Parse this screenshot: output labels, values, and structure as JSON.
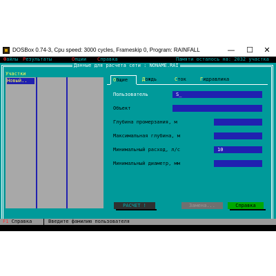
{
  "window": {
    "title": "DOSBox 0.74-3, Cpu speed:    3000 cycles, Frameskip  0, Program: RAINFALL",
    "minimize": "—",
    "maximize": "☐",
    "close": "✕"
  },
  "menu": {
    "items": [
      {
        "hotkey": "Ф",
        "rest": "айлы"
      },
      {
        "hotkey": "Р",
        "rest": "езультаты"
      },
      {
        "hotkey": "О",
        "rest": "пции"
      },
      {
        "hotkey": "С",
        "rest": "правка"
      }
    ],
    "memory": "Памяти осталось на:   2032 участка"
  },
  "frame": {
    "title": " Данные для расчета сети : NONAME.RAI "
  },
  "sidebar": {
    "label": "Участки",
    "items": [
      {
        "label": "Новый.."
      }
    ]
  },
  "tabs": [
    {
      "hotkey": "О",
      "rest": "бщие",
      "active": true
    },
    {
      "hotkey": "Д",
      "rest": "ождь",
      "active": false
    },
    {
      "hotkey": "С",
      "rest": "ток",
      "active": false
    },
    {
      "hotkey": "Г",
      "rest": "идравлика",
      "active": false
    }
  ],
  "fields": [
    {
      "label": "Пользователь",
      "value": "S_"
    },
    {
      "label": "Объект",
      "value": ""
    },
    {
      "label": "Глубина промерзания, м",
      "value": ""
    },
    {
      "label": "Максимальная глубина, м",
      "value": ""
    },
    {
      "label": "Минимальный расход, л/с",
      "value": "10"
    },
    {
      "label": "Минимальный диаметр, мм",
      "value": ""
    }
  ],
  "buttons": {
    "calc": "РАСЧЕТ !",
    "change": "Замена...",
    "help": "Справка"
  },
  "status": {
    "hotkey": "F1",
    "key_label": " Справка",
    "message": "Введите фамилию пользователя"
  },
  "colors": {
    "background": "#009a9a",
    "field": "#2020b0",
    "highlight": "#ffff55",
    "hotkey": "#ff3030"
  }
}
